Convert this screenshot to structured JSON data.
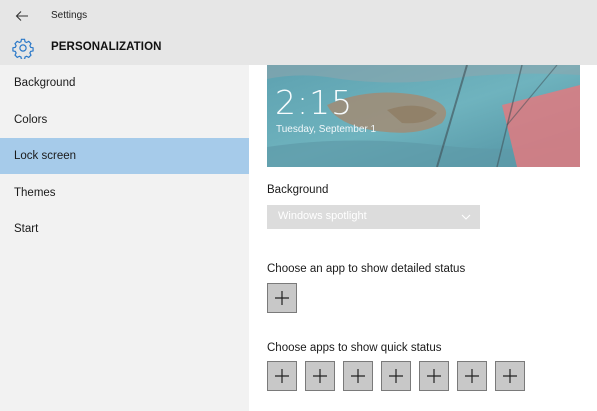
{
  "window": {
    "title": "Settings"
  },
  "header": {
    "title": "PERSONALIZATION",
    "icon": "gear-icon"
  },
  "sidebar": {
    "items": [
      {
        "label": "Background"
      },
      {
        "label": "Colors"
      },
      {
        "label": "Lock screen",
        "selected": true
      },
      {
        "label": "Themes"
      },
      {
        "label": "Start"
      }
    ]
  },
  "lockscreen": {
    "preview": {
      "time": "2:15",
      "date": "Tuesday, September 1"
    },
    "background": {
      "label": "Background",
      "value": "Windows spotlight"
    },
    "detailed_status": {
      "label": "Choose an app to show detailed status",
      "buttons": 1
    },
    "quick_status": {
      "label": "Choose apps to show quick status",
      "buttons": 7
    }
  },
  "colors": {
    "accent_selected": "#a6cbea",
    "titlebar": "#e6e6e6",
    "sidebar": "#f2f2f2"
  }
}
